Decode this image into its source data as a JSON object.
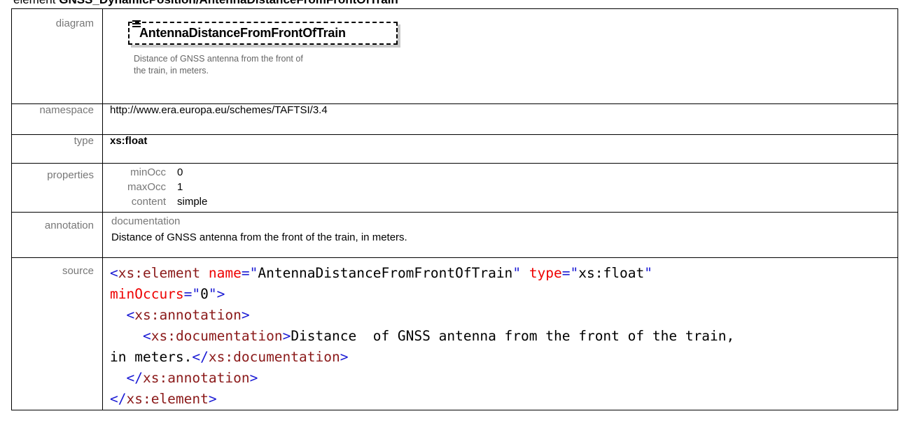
{
  "heading": {
    "prefix": "element",
    "path": "GNSS_DynamicPosition/AntennaDistanceFromFrontOfTrain"
  },
  "labels": {
    "diagram": "diagram",
    "namespace": "namespace",
    "type": "type",
    "properties": "properties",
    "annotation": "annotation",
    "source": "source"
  },
  "diagram": {
    "element_name": "AntennaDistanceFromFrontOfTrain",
    "documentation": "Distance  of GNSS antenna from the front of the train, in meters."
  },
  "namespace": "http://www.era.europa.eu/schemes/TAFTSI/3.4",
  "type": "xs:float",
  "properties": [
    {
      "key": "minOcc",
      "value": "0"
    },
    {
      "key": "maxOcc",
      "value": "1"
    },
    {
      "key": "content",
      "value": "simple"
    }
  ],
  "annotation": {
    "key": "documentation",
    "value": "Distance  of GNSS antenna from the front of the train, in meters."
  },
  "source": {
    "element_tag": "xs:element",
    "name_attr": "name",
    "name_value": "AntennaDistanceFromFrontOfTrain",
    "type_attr": "type",
    "type_value": "xs:float",
    "minoccurs_attr": "minOccurs",
    "minoccurs_value": "0",
    "annotation_tag": "xs:annotation",
    "documentation_tag": "xs:documentation",
    "doc_text_line1": "Distance  of GNSS antenna from the front of the train,",
    "doc_text_line2": "in meters."
  },
  "colors": {
    "tag": "#8b1a1a",
    "bracket": "#1a1ad4",
    "attribute": "#ee0000",
    "label": "#777777"
  }
}
